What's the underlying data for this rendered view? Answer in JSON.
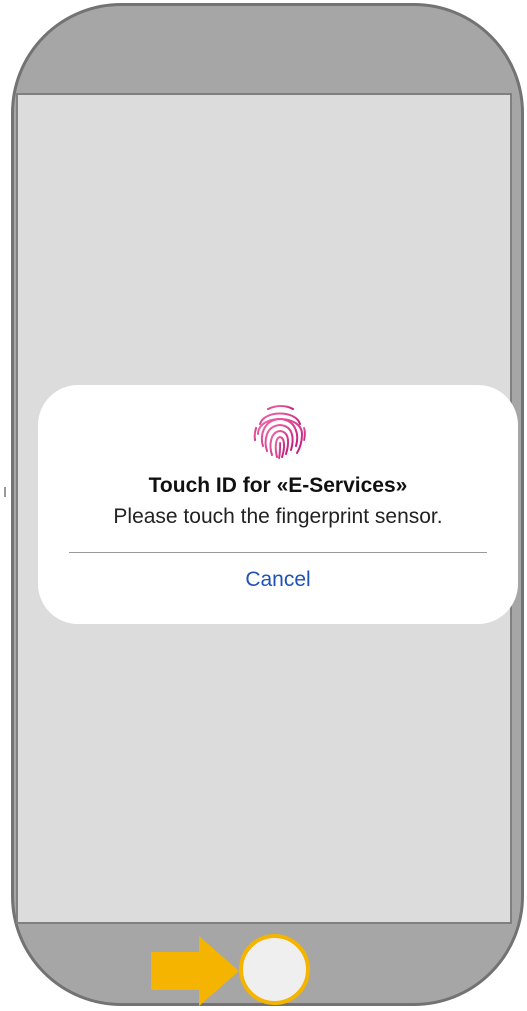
{
  "dialog": {
    "title": "Touch ID for «E-Services»",
    "message": "Please touch the fingerprint sensor.",
    "cancel_label": "Cancel",
    "icon": "fingerprint-icon"
  },
  "device": {
    "home_button_icon": "home-button",
    "indicator_icon": "arrow-right-icon"
  },
  "colors": {
    "phone_body": "#a6a6a6",
    "screen": "#dcdcdc",
    "fingerprint": "#e83d9e",
    "link": "#1f52b8",
    "accent": "#f4b400"
  }
}
